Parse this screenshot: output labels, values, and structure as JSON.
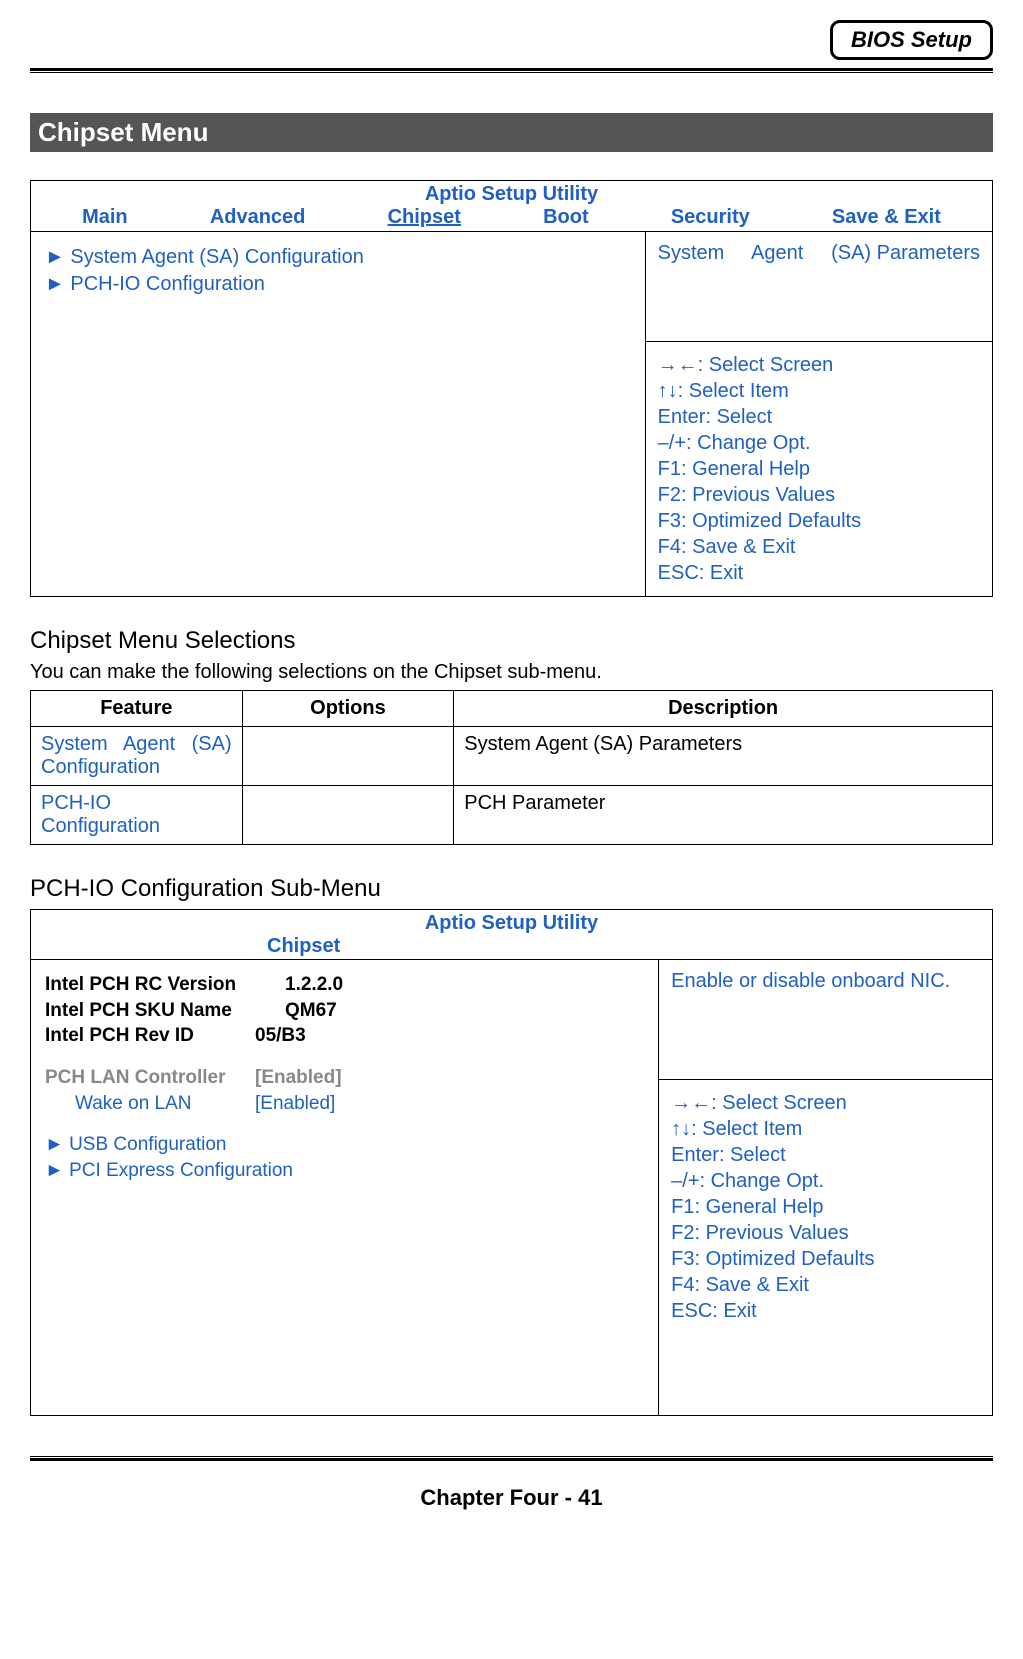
{
  "header": {
    "tag": "BIOS Setup"
  },
  "section_title": "Chipset Menu",
  "bios1": {
    "utility_title": "Aptio Setup Utility",
    "tabs": [
      "Main",
      "Advanced",
      "Chipset",
      "Boot",
      "Security",
      "Save & Exit"
    ],
    "active_tab": "Chipset",
    "left_items": [
      "► System Agent (SA) Configuration",
      "► PCH-IO Configuration"
    ],
    "right_top": "System     Agent     (SA) Parameters",
    "help": [
      "→←: Select Screen",
      "↑↓: Select Item",
      "Enter: Select",
      "–/+: Change Opt.",
      "F1: General Help",
      "F2: Previous Values",
      "F3: Optimized Defaults",
      "F4: Save & Exit",
      "ESC: Exit"
    ]
  },
  "selections": {
    "heading": "Chipset Menu Selections",
    "intro": "You can make the following selections on the Chipset sub-menu.",
    "headers": [
      "Feature",
      "Options",
      "Description"
    ],
    "rows": [
      {
        "feature": "System Agent (SA) Configuration",
        "options": "",
        "description": "System Agent (SA) Parameters"
      },
      {
        "feature": "PCH-IO Configuration",
        "options": "",
        "description": "PCH Parameter"
      }
    ]
  },
  "bios2": {
    "heading": "PCH-IO Configuration Sub-Menu",
    "utility_title": "Aptio Setup Utility",
    "tab": "Chipset",
    "info_rows": [
      {
        "label": "Intel PCH RC Version",
        "value": "1.2.2.0",
        "style": "bold"
      },
      {
        "label": "Intel PCH SKU Name",
        "value": "QM67",
        "style": "bold"
      },
      {
        "label": "Intel PCH Rev ID",
        "value": "05/B3",
        "style": "bold"
      }
    ],
    "config_rows": [
      {
        "label": "PCH LAN Controller",
        "value": "[Enabled]",
        "style": "grey",
        "indent": false
      },
      {
        "label": "Wake on LAN",
        "value": "[Enabled]",
        "style": "blue",
        "indent": true
      }
    ],
    "sub_links": [
      "► USB Configuration",
      "► PCI Express Configuration"
    ],
    "right_top": "Enable or disable onboard NIC.",
    "help": [
      "→←: Select Screen",
      "↑↓: Select Item",
      "Enter: Select",
      "–/+: Change Opt.",
      "F1: General Help",
      "F2: Previous Values",
      "F3: Optimized Defaults",
      "F4: Save & Exit",
      "ESC: Exit"
    ]
  },
  "footer": "Chapter Four - 41"
}
